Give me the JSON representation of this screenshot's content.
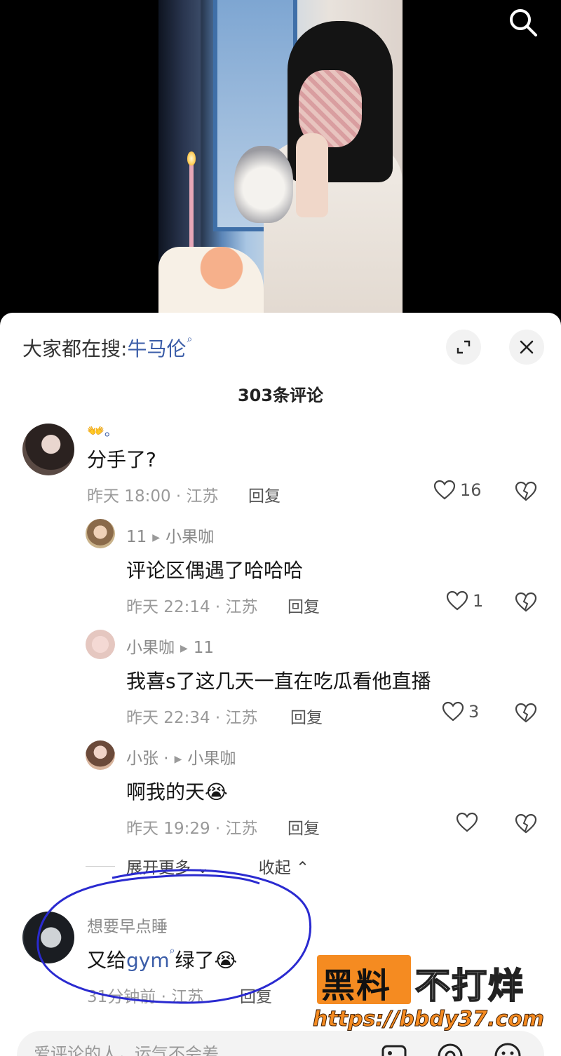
{
  "video": {
    "search_icon": "search-icon"
  },
  "sheet": {
    "trending_prefix": "大家都在搜:",
    "trending_keyword": "牛马伦",
    "comment_count": "303条评论",
    "expand_icon": "expand-icon",
    "close_icon": "close-icon"
  },
  "comments": [
    {
      "name": "👐。",
      "text": "分手了?",
      "meta": "昨天 18:00 · 江苏",
      "reply_label": "回复",
      "likes": "16"
    }
  ],
  "replies": [
    {
      "name_from": "11",
      "name_to": "小果咖",
      "text": "评论区偶遇了哈哈哈",
      "meta": "昨天 22:14 · 江苏",
      "reply_label": "回复",
      "likes": "1"
    },
    {
      "name_from": "小果咖",
      "name_to": "11",
      "text": "我喜s了这几天一直在吃瓜看他直播",
      "meta": "昨天 22:34 · 江苏",
      "reply_label": "回复",
      "likes": "3"
    },
    {
      "name_from": "小张 ·",
      "name_to": "小果咖",
      "text": "啊我的天😭",
      "meta": "昨天 19:29 · 江苏",
      "reply_label": "回复",
      "likes": ""
    }
  ],
  "thread_controls": {
    "expand_more": "展开更多",
    "collapse": "收起"
  },
  "highlighted_comment": {
    "name": "想要早点睡",
    "text_prefix": "又给",
    "text_link": "gym",
    "text_suffix": "绿了😭",
    "meta": "31分钟前 · 江苏",
    "reply_label": "回复"
  },
  "watermark": {
    "badge": "黑料",
    "title": "不打烊",
    "url": "https://bbdy37.com"
  },
  "input": {
    "placeholder": "爱评论的人，运气不会差"
  },
  "colors": {
    "accent_link": "#3b5da8",
    "watermark_orange": "#f58b21",
    "loop_blue": "#2a2ad0"
  }
}
